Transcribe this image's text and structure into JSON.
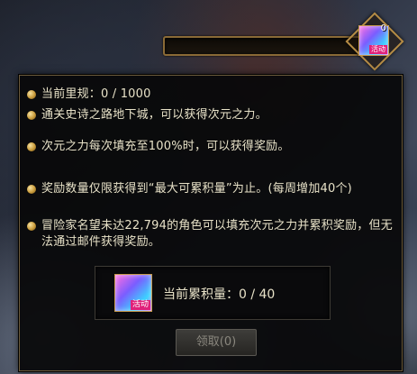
{
  "top_item": {
    "count": "0",
    "tag": "活动"
  },
  "top_bar": {
    "progress": 0
  },
  "tooltip": {
    "lines": [
      "当前里规：0 / 1000",
      "通关史诗之路地下城，可以获得次元之力。",
      "次元之力每次填充至100%时，可以获得奖励。",
      "奖励数量仅限获得到“最大可累积量”为止。(每周增加40个)",
      "冒险家名望未达22,794的角色可以填充次元之力并累积奖励，但无法通过邮件获得奖励。"
    ],
    "reward": {
      "icon_tag": "活动",
      "label": "当前累积量：0 / 40"
    },
    "claim_button": "领取(0)"
  }
}
